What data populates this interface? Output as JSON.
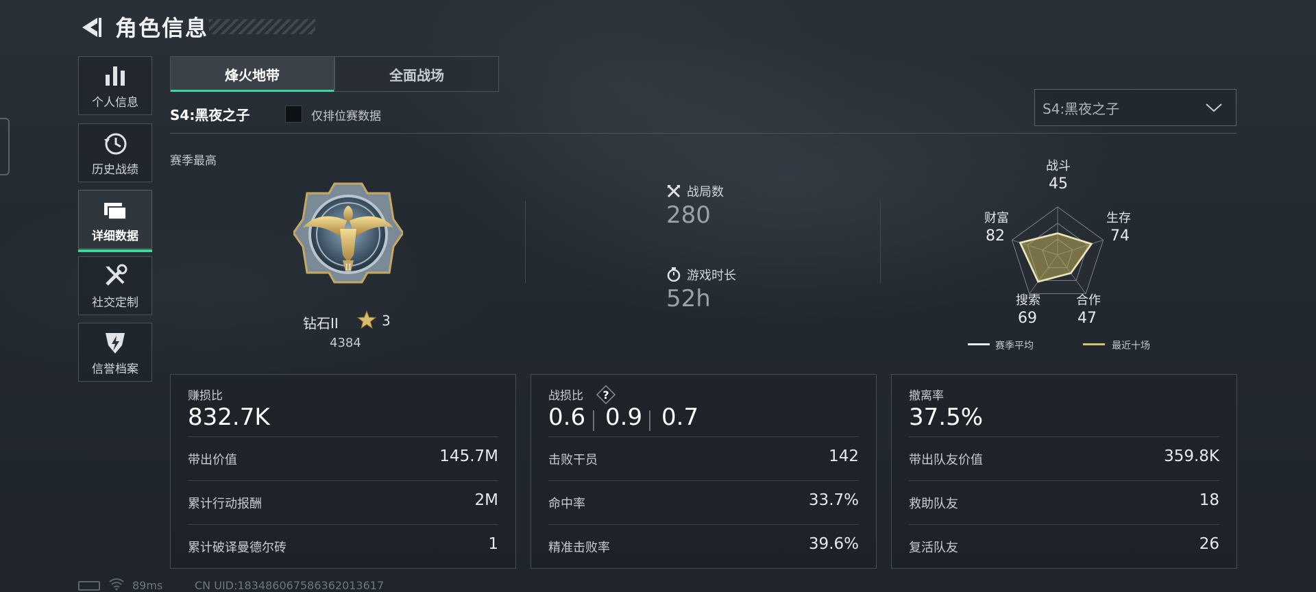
{
  "header": {
    "title": "角色信息"
  },
  "sidebar": {
    "items": [
      {
        "label": "个人信息",
        "icon": "bar-chart-icon"
      },
      {
        "label": "历史战绩",
        "icon": "history-clock-icon"
      },
      {
        "label": "详细数据",
        "icon": "folder-icon",
        "active": true
      },
      {
        "label": "社交定制",
        "icon": "tools-icon"
      },
      {
        "label": "信誉档案",
        "icon": "shield-icon"
      }
    ]
  },
  "tabs": [
    {
      "label": "烽火地带",
      "active": true
    },
    {
      "label": "全面战场",
      "active": false
    }
  ],
  "season": {
    "label": "S4:黑夜之子",
    "ranked_only_label": "仅排位赛数据",
    "ranked_only_checked": false,
    "select_value": "S4:黑夜之子"
  },
  "season_best": {
    "label": "赛季最高",
    "rank_name": "钻石II",
    "rank_stars": "3",
    "rank_score": "4384"
  },
  "summary": {
    "matches_label": "战局数",
    "matches_value": "280",
    "playtime_label": "游戏时长",
    "playtime_value": "52h"
  },
  "radar": {
    "axes": [
      {
        "label": "战斗",
        "value": "45"
      },
      {
        "label": "生存",
        "value": "74"
      },
      {
        "label": "合作",
        "value": "47"
      },
      {
        "label": "搜索",
        "value": "69"
      },
      {
        "label": "财富",
        "value": "82"
      }
    ],
    "legend": [
      {
        "label": "赛季平均",
        "color": "#e8ecef"
      },
      {
        "label": "最近十场",
        "color": "#d6c66a"
      }
    ]
  },
  "cards": {
    "profit": {
      "title": "赚损比",
      "value": "832.7K",
      "rows": [
        {
          "label": "带出价值",
          "value": "145.7M"
        },
        {
          "label": "累计行动报酬",
          "value": "2M"
        },
        {
          "label": "累计破译曼德尔砖",
          "value": "1"
        }
      ]
    },
    "kd": {
      "title": "战损比",
      "values": [
        "0.6",
        "0.9",
        "0.7"
      ],
      "rows": [
        {
          "label": "击败干员",
          "value": "142"
        },
        {
          "label": "命中率",
          "value": "33.7%"
        },
        {
          "label": "精准击败率",
          "value": "39.6%"
        }
      ]
    },
    "extract": {
      "title": "撤离率",
      "value": "37.5%",
      "rows": [
        {
          "label": "带出队友价值",
          "value": "359.8K"
        },
        {
          "label": "救助队友",
          "value": "18"
        },
        {
          "label": "复活队友",
          "value": "26"
        }
      ]
    }
  },
  "footer": {
    "ping": "89ms",
    "uid": "CN UID:1834860675863620136​17"
  },
  "colors": {
    "accent": "#3fd69a",
    "gold": "#d6c66a"
  }
}
